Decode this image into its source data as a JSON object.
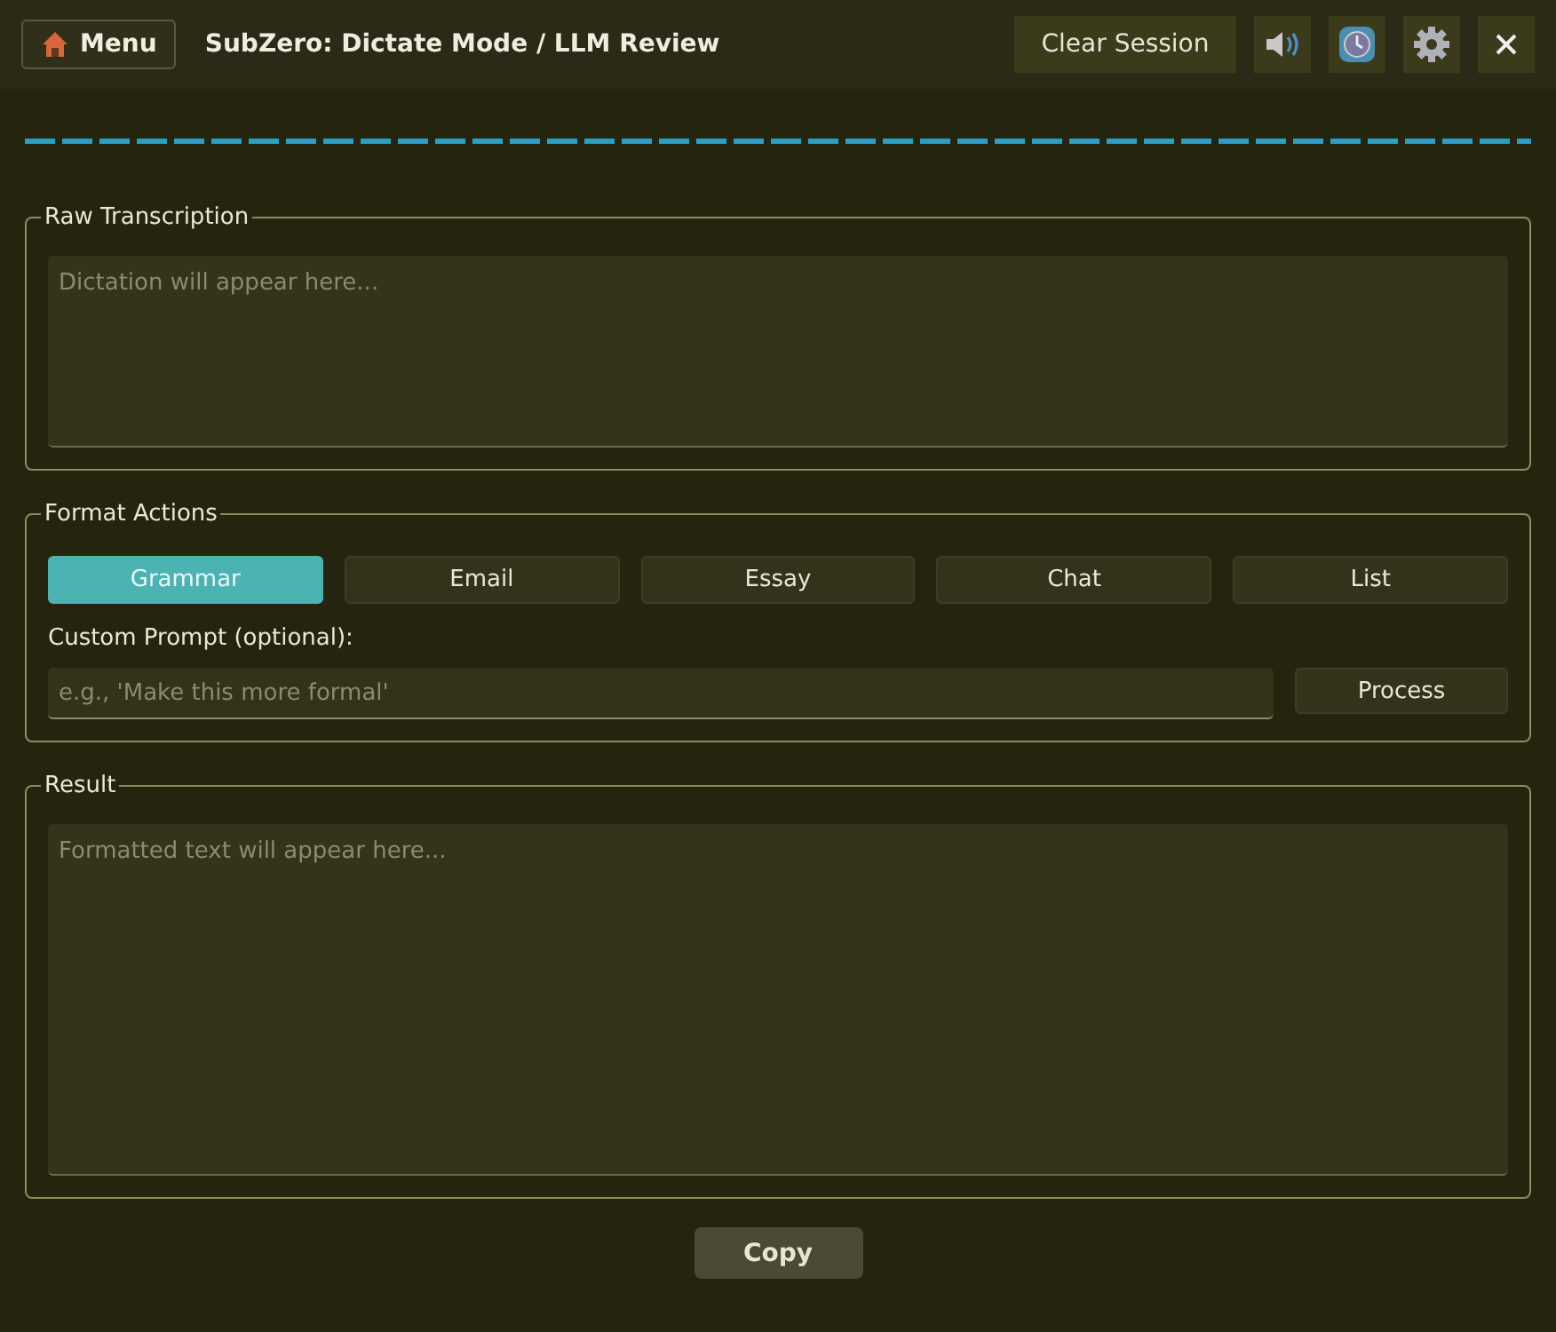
{
  "header": {
    "menu_button": "Menu",
    "title": "SubZero: Dictate Mode / LLM Review",
    "clear_button": "Clear Session"
  },
  "raw_transcription": {
    "legend": "Raw Transcription",
    "placeholder": "Dictation will appear here..."
  },
  "format_actions": {
    "legend": "Format Actions",
    "buttons": [
      {
        "label": "Grammar",
        "selected": true
      },
      {
        "label": "Email",
        "selected": false
      },
      {
        "label": "Essay",
        "selected": false
      },
      {
        "label": "Chat",
        "selected": false
      },
      {
        "label": "List",
        "selected": false
      }
    ],
    "custom_prompt_label": "Custom Prompt (optional):",
    "custom_prompt": {
      "placeholder": "e.g., 'Make this more formal'"
    },
    "process_button": "Process"
  },
  "result": {
    "legend": "Result",
    "placeholder": "Formatted text will appear here..."
  },
  "copy_button": "Copy"
}
